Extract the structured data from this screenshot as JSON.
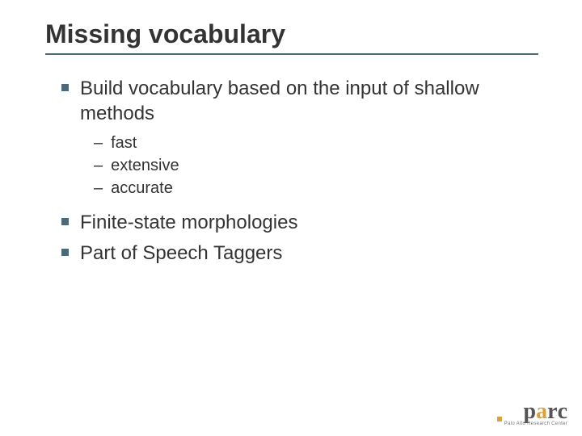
{
  "title": "Missing vocabulary",
  "bullets": [
    {
      "text": "Build vocabulary based on the input of shallow methods",
      "sub": [
        "fast",
        "extensive",
        "accurate"
      ]
    },
    {
      "text": "Finite-state morphologies"
    },
    {
      "text": "Part of Speech Taggers"
    }
  ],
  "logo": {
    "letters": [
      "p",
      "a",
      "r",
      "c"
    ],
    "subtitle": "Palo Alto Research Center"
  }
}
